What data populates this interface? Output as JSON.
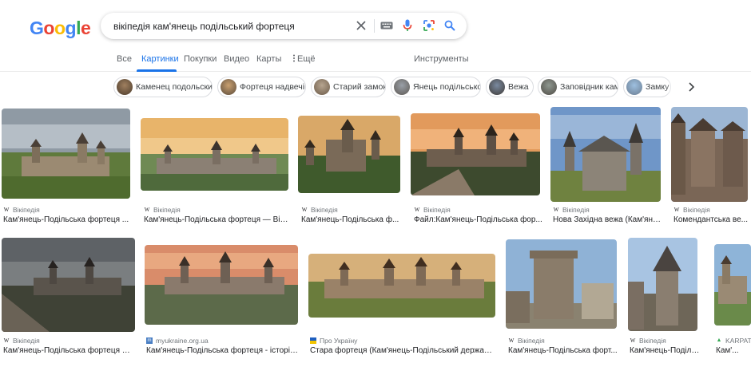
{
  "colors": {
    "google_blue": "#4285F4",
    "google_red": "#EA4335",
    "google_yellow": "#FBBC05",
    "google_green": "#34A853",
    "accent": "#1a73e8"
  },
  "logo": {
    "letters": [
      "G",
      "o",
      "o",
      "g",
      "l",
      "e"
    ]
  },
  "search": {
    "query": "вікіпедія кам'янець подільський фортеця",
    "icons": [
      "clear-icon",
      "keyboard-icon",
      "microphone-icon",
      "lens-icon",
      "search-icon"
    ]
  },
  "tabs": [
    {
      "label": "Все"
    },
    {
      "label": "Картинки",
      "active": true
    },
    {
      "label": "Покупки"
    },
    {
      "label": "Видео"
    },
    {
      "label": "Карты"
    },
    {
      "label": "Ещё",
      "icon": "more-vert-icon"
    }
  ],
  "tools_label": "Инструменты",
  "chips": [
    {
      "label": "Каменец подольский"
    },
    {
      "label": "Фортеця надвечір"
    },
    {
      "label": "Старий замок"
    },
    {
      "label": "Янець подільської"
    },
    {
      "label": "Вежа"
    },
    {
      "label": "Заповідник кам"
    },
    {
      "label": "Замку"
    }
  ],
  "results": [
    {
      "source": "Вікіпедія",
      "title": "Кам'янець-Подільська фортеця ..."
    },
    {
      "source": "Вікіпедія",
      "title": "Кам'янець-Подільська фортеця — Вікі..."
    },
    {
      "source": "Вікіпедія",
      "title": "Кам'янець-Подільська ф..."
    },
    {
      "source": "Вікіпедія",
      "title": "Файл:Кам'янець-Подільська фор..."
    },
    {
      "source": "Вікіпедія",
      "title": "Нова Західна вежа (Кам'яне..."
    },
    {
      "source": "Вікіпедія",
      "title": "Комендантська ве..."
    },
    {
      "source": "Вікіпедія",
      "title": "Кам'янець-Подільська фортеця —..."
    },
    {
      "source": "myukraine.org.ua",
      "title": "Кам'янець-Подільська фортеця - історія..."
    },
    {
      "source": "Про Україну",
      "title": "Стара фортеця (Кам'янець-Подільський державн..."
    },
    {
      "source": "Вікіпедія",
      "title": "Кам'янець-Подільська форт..."
    },
    {
      "source": "Вікіпедія",
      "title": "Кам'янець-Подільс..."
    },
    {
      "source": "KARPATY",
      "title": "Кам'..."
    }
  ]
}
